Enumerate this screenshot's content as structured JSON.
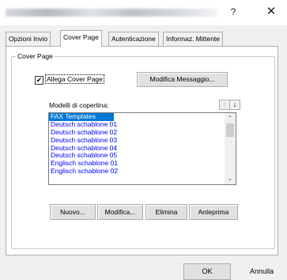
{
  "titlebar": {
    "help_label": "?",
    "close_label": "✕"
  },
  "tabs": [
    {
      "label": "Opzioni Invio"
    },
    {
      "label": "Cover Page"
    },
    {
      "label": "Autenticazione"
    },
    {
      "label": "Informaz. Mittente"
    }
  ],
  "cover_page": {
    "group_label": "Cover Page",
    "checkbox_label": "Allega Cover Page",
    "checkbox_checked": "✔",
    "edit_message_button": "Modifica Messaggio...",
    "models_label": "Modelli di copertina:",
    "arrow_up": "↑",
    "arrow_down": "↓",
    "templates": [
      "FAX Templates",
      "Deutsch schablone 01",
      "Deutsch schablone 02",
      "Deutsch schablone 03",
      "Deutsch schablone 04",
      "Deutsch schablone 05",
      "Englisch schablone 01",
      "Englisch schablone 02"
    ],
    "new_button": "Nuovo...",
    "modify_button": "Modifica...",
    "delete_button": "Elimina",
    "preview_button": "Anteprima"
  },
  "footer": {
    "ok_label": "OK",
    "cancel_label": "Annulla"
  },
  "colors": {
    "list_text": "#0000ff",
    "selection": "#0078d7"
  }
}
